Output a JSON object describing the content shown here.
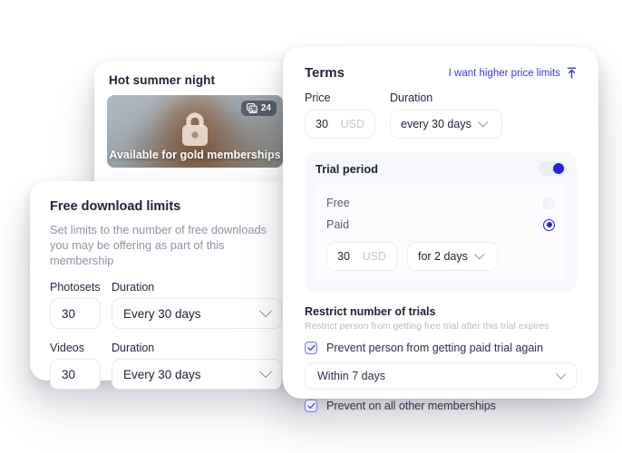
{
  "photo_card": {
    "title": "Hot summer night",
    "badge_count": "24",
    "badge_icon": "photo-stack-icon",
    "lock_icon": "lock-icon",
    "caption": "Available for gold memberships"
  },
  "limits_card": {
    "title": "Free download limits",
    "description": "Set limits to the number of free downloads you may be offering as part of this membership",
    "rows": [
      {
        "count_label": "Photosets",
        "count_value": "30",
        "duration_label": "Duration",
        "duration_value": "Every 30 days"
      },
      {
        "count_label": "Videos",
        "count_value": "30",
        "duration_label": "Duration",
        "duration_value": "Every 30 days"
      }
    ]
  },
  "terms_card": {
    "title": "Terms",
    "link_label": "I want higher price limits",
    "link_icon": "upload-arrow-icon",
    "price_label": "Price",
    "price_value": "30",
    "price_currency": "USD",
    "duration_label": "Duration",
    "duration_value": "every 30 days",
    "trial": {
      "title": "Trial period",
      "toggle_on": true,
      "options": [
        {
          "label": "Free",
          "selected": false
        },
        {
          "label": "Paid",
          "selected": true
        }
      ],
      "amount_value": "30",
      "amount_currency": "USD",
      "period_value": "for 2 days"
    },
    "restrict": {
      "title": "Restrict number of trials",
      "subtitle": "Restrict person from getting free trial after this trial expires",
      "checkbox_paid_again": "Prevent person from getting paid trial again",
      "window_value": "Within 7 days",
      "checkbox_all_memberships": "Prevent on all other memberships"
    }
  },
  "colors": {
    "accent_blue": "#2a21e8",
    "link_blue": "#3b34f0",
    "text_dark": "#1d2236",
    "text_muted": "#8f93a8",
    "panel_tint": "#f7f8fc"
  }
}
